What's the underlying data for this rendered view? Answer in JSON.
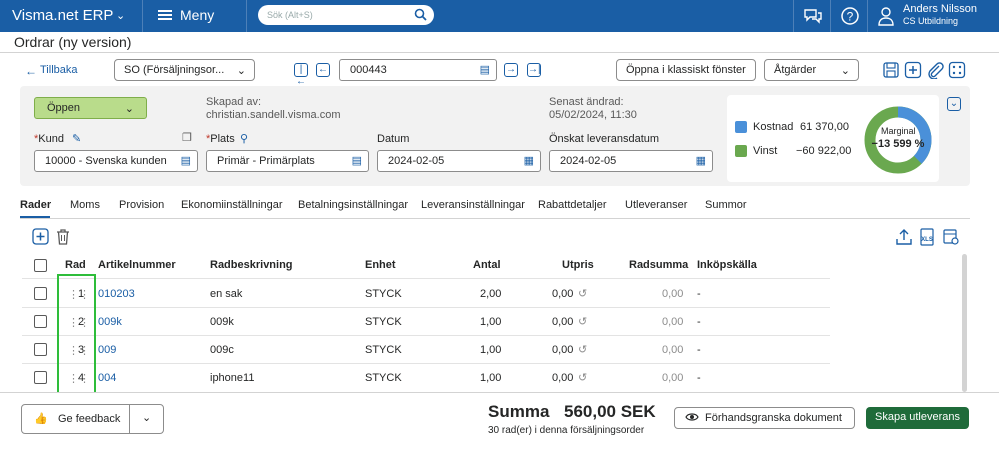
{
  "topbar": {
    "brand": "Visma.net ERP",
    "menu_label": "Meny",
    "search_placeholder": "Sök (Alt+S)",
    "user_name": "Anders Nilsson",
    "user_company": "CS Utbildning"
  },
  "page": {
    "title": "Ordrar (ny version)"
  },
  "toolbar": {
    "back_label": "Tillbaka",
    "order_type": "SO (Försäljningsor...",
    "order_number": "000443",
    "classic_label": "Öppna i klassiskt fönster",
    "actions_label": "Åtgärder"
  },
  "header": {
    "status": "Öppen",
    "created_by_label": "Skapad av:",
    "created_by": "christian.sandell.visma.com",
    "last_changed_label": "Senast ändrad:",
    "last_changed": "05/02/2024, 11:30",
    "customer_label": "Kund",
    "customer_value": "10000 - Svenska kunden",
    "location_label": "Plats",
    "location_value": "Primär - Primärplats",
    "date_label": "Datum",
    "date_value": "2024-02-05",
    "requested_label": "Önskat leveransdatum",
    "requested_value": "2024-02-05",
    "cost_label": "Kostnad",
    "cost_value": "61 370,00",
    "profit_label": "Vinst",
    "profit_value": "−60 922,00",
    "margin_label": "Marginal",
    "margin_value": "−13 599 %",
    "cost_color": "#4a90d9",
    "profit_color": "#6aa84f"
  },
  "tabs": [
    "Rader",
    "Moms",
    "Provision",
    "Ekonomiinställningar",
    "Betalningsinställningar",
    "Leveransinställningar",
    "Rabattdetaljer",
    "Utleveranser",
    "Summor"
  ],
  "grid": {
    "columns": [
      "Rad",
      "Artikelnummer",
      "Radbeskrivning",
      "Enhet",
      "Antal",
      "Utpris",
      "Radsumma",
      "Inköpskälla"
    ],
    "rows": [
      {
        "rad": "1",
        "artikel": "010203",
        "beskrivning": "en sak",
        "enhet": "STYCK",
        "antal": "2,00",
        "utpris": "0,00",
        "radsumma": "0,00",
        "kalla": "-"
      },
      {
        "rad": "2",
        "artikel": "009k",
        "beskrivning": "009k",
        "enhet": "STYCK",
        "antal": "1,00",
        "utpris": "0,00",
        "radsumma": "0,00",
        "kalla": "-"
      },
      {
        "rad": "3",
        "artikel": "009",
        "beskrivning": "009c",
        "enhet": "STYCK",
        "antal": "1,00",
        "utpris": "0,00",
        "radsumma": "0,00",
        "kalla": "-"
      },
      {
        "rad": "4",
        "artikel": "004",
        "beskrivning": "iphone11",
        "enhet": "STYCK",
        "antal": "1,00",
        "utpris": "0,00",
        "radsumma": "0,00",
        "kalla": "-"
      }
    ]
  },
  "footer": {
    "feedback_label": "Ge feedback",
    "sum_label": "Summa",
    "sum_value": "560,00 SEK",
    "row_count": "30 rad(er) i denna försäljningsorder",
    "preview_label": "Förhandsgranska dokument",
    "create_label": "Skapa utleverans"
  }
}
